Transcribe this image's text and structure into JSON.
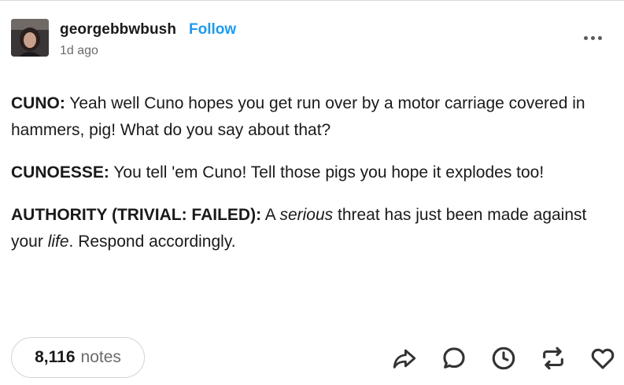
{
  "post": {
    "username": "georgebbwbush",
    "follow_label": "Follow",
    "timestamp": "1d ago",
    "paragraphs": [
      {
        "speaker": "CUNO:",
        "text": " Yeah well Cuno hopes you get run over by a motor carriage covered in hammers, pig! What do you say about that?"
      },
      {
        "speaker": "CUNOESSE:",
        "text": " You tell 'em Cuno! Tell those pigs you hope it explodes too!"
      },
      {
        "speaker": "AUTHORITY (TRIVIAL: FAILED):",
        "text_1": " A ",
        "emph_1": "serious",
        "text_2": " threat has just been made against your ",
        "emph_2": "life",
        "text_3": ". Respond accordingly."
      }
    ],
    "notes_count": "8,116",
    "notes_label": "notes"
  },
  "icons": {
    "more": "more-horizontal-icon",
    "share": "share-icon",
    "reply": "reply-icon",
    "queue": "clock-icon",
    "reblog": "reblog-icon",
    "like": "heart-icon"
  },
  "colors": {
    "follow": "#1d9bf0",
    "text": "#1a1a1a",
    "muted": "#6b6b6b",
    "icon": "#333333"
  }
}
